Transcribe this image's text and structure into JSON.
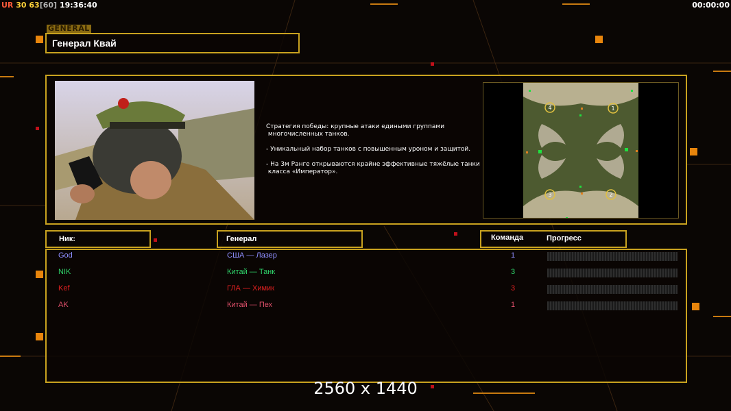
{
  "hud": {
    "ur": "UR",
    "val1": "30",
    "val2": "63",
    "val3": "[60]",
    "clock": "19:36:40",
    "timer": "00:00:00"
  },
  "general_tag": "GENERAL",
  "title": "Генерал Квай",
  "description": [
    "Стратегия победы: крупные атаки едиными группами\n многочисленных танков.",
    "- Уникальный набор танков с повышенным уроном и защитой.",
    "- На 3м Ранге открываются крайне эффективные тяжёлые танки\n класса «Император»."
  ],
  "headers": {
    "nick": "Ник:",
    "general": "Генерал",
    "team": "Команда",
    "progress": "Прогресс"
  },
  "players": [
    {
      "nick": "God",
      "general": "США — Лазер",
      "team": "1",
      "color": "#8f8fff"
    },
    {
      "nick": "NIK",
      "general": "Китай — Танк",
      "team": "3",
      "color": "#2fd36a"
    },
    {
      "nick": "Kef",
      "general": "ГЛА — Химик",
      "team": "3",
      "color": "#e02020"
    },
    {
      "nick": "AK",
      "general": "Китай — Пех",
      "team": "1",
      "color": "#e0506a"
    }
  ],
  "minimap_slots": [
    "4",
    "1",
    "3",
    "2"
  ],
  "watermark": "2560 x 1440",
  "colors": {
    "accent": "#c9a21f",
    "bg": "#0a0604"
  }
}
